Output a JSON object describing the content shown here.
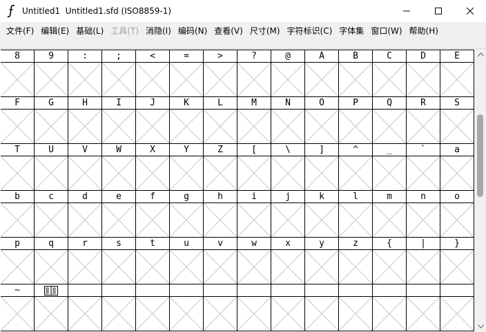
{
  "window": {
    "title": "Untitled1  Untitled1.sfd (ISO8859-1)",
    "app_icon": "fontforge-icon",
    "controls": [
      "minimize-icon",
      "maximize-icon",
      "close-icon"
    ]
  },
  "menu": [
    {
      "label": "文件(F)",
      "enabled": true
    },
    {
      "label": "编辑(E)",
      "enabled": true
    },
    {
      "label": "基础(L)",
      "enabled": true
    },
    {
      "label": "工具(T)",
      "enabled": false
    },
    {
      "label": "消隐(I)",
      "enabled": true
    },
    {
      "label": "编码(N)",
      "enabled": true
    },
    {
      "label": "查看(V)",
      "enabled": true
    },
    {
      "label": "尺寸(M)",
      "enabled": true
    },
    {
      "label": "字符标识(C)",
      "enabled": true
    },
    {
      "label": "字体集",
      "enabled": true
    },
    {
      "label": "窗口(W)",
      "enabled": true
    },
    {
      "label": "帮助(H)",
      "enabled": true
    }
  ],
  "glyph_rows": [
    [
      "8",
      "9",
      ":",
      ";",
      "<",
      "=",
      ">",
      "?",
      "@",
      "A",
      "B",
      "C",
      "D",
      "E"
    ],
    [
      "F",
      "G",
      "H",
      "I",
      "J",
      "K",
      "L",
      "M",
      "N",
      "O",
      "P",
      "Q",
      "R",
      "S"
    ],
    [
      "T",
      "U",
      "V",
      "W",
      "X",
      "Y",
      "Z",
      "[",
      "\\",
      "]",
      "^",
      "_",
      "`",
      "a"
    ],
    [
      "b",
      "c",
      "d",
      "e",
      "f",
      "g",
      "h",
      "i",
      "j",
      "k",
      "l",
      "m",
      "n",
      "o"
    ],
    [
      "p",
      "q",
      "r",
      "s",
      "t",
      "u",
      "v",
      "w",
      "x",
      "y",
      "z",
      "{",
      "|",
      "}"
    ],
    [
      "~",
      "",
      "",
      "",
      "",
      "",
      "",
      "",
      "",
      "",
      "",
      "",
      "",
      ""
    ]
  ],
  "special_cell": {
    "row": 5,
    "col": 1,
    "icon": "control-char-box-icon"
  },
  "colors": {
    "grid_line": "#000000",
    "empty_cross": "#c8c8c8",
    "menubar_bg": "#f0f0f0",
    "disabled_text": "#a0a0a0",
    "scroll_thumb": "#a8a8a8"
  }
}
